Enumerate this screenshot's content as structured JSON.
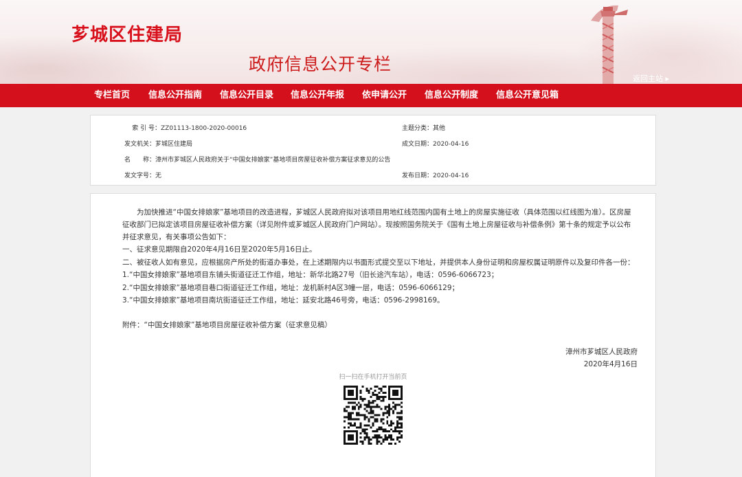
{
  "header": {
    "site_name": "芗城区住建局",
    "subtitle": "政府信息公开专栏",
    "return_home": "返回主站 ▸"
  },
  "nav": {
    "items": [
      {
        "label": "专栏首页"
      },
      {
        "label": "信息公开指南"
      },
      {
        "label": "信息公开目录"
      },
      {
        "label": "信息公开年报"
      },
      {
        "label": "依申请公开"
      },
      {
        "label": "信息公开制度"
      },
      {
        "label": "信息公开意见箱"
      }
    ]
  },
  "meta": {
    "index_label": "索 引 号：",
    "index_value": "ZZ01113-1800-2020-00016",
    "topic_label": "主题分类：",
    "topic_value": "其他",
    "issuer_label": "发文机关：",
    "issuer_value": "芗城区住建局",
    "created_label": "成文日期：",
    "created_value": "2020-04-16",
    "name_label": "名　　称：",
    "name_value": "漳州市芗城区人民政府关于“中国女排娘家”基地项目房屋征收补偿方案征求意见的公告",
    "docno_label": "发文字号：",
    "docno_value": "无",
    "published_label": "发布日期：",
    "published_value": "2020-04-16"
  },
  "content": {
    "intro": "为加快推进“中国女排娘家”基地项目的改造进程，芗城区人民政府拟对该项目用地红线范围内国有土地上的房屋实施征收（具体范围以红线图为准）。区房屋征收部门已拟定该项目房屋征收补偿方案（详见附件或芗城区人民政府门户网站）。现按照国务院关于《国有土地上房屋征收与补偿条例》第十条的规定予以公布并征求意见，有关事项公告如下：",
    "item1": "一、征求意见期限自2020年4月16日至2020年5月16日止。",
    "item2": "二、被征收人如有意见，应根据房产所处的街道办事处，在上述期限内以书面形式提交至以下地址，并提供本人身份证明和房屋权属证明原件以及复印件各一份：",
    "addr1": "1.“中国女排娘家”基地项目东铺头街道征迁工作组，地址：新华北路27号（旧长途汽车站），电话：0596-6066723；",
    "addr2": "2.“中国女排娘家”基地项目巷口街道征迁工作组，地址：龙机新村A区3幢一层，电话：0596-6066129；",
    "addr3": "3.“中国女排娘家”基地项目南坑街道征迁工作组，地址：延安北路46号旁，电话：0596-2998169。",
    "attachment": "附件：“中国女排娘家”基地项目房屋征收补偿方案（征求意见稿）",
    "signature": "漳州市芗城区人民政府",
    "date": "2020年4月16日",
    "qr_caption": "扫一扫在手机打开当前页"
  },
  "colors": {
    "brand_red": "#d3101c",
    "title_red": "#d7101b"
  }
}
